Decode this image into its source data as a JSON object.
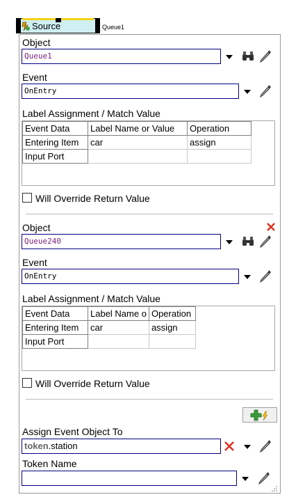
{
  "header": {
    "source_label": "Source",
    "queue_label": "Queue1"
  },
  "assignments": [
    {
      "object_label": "Object",
      "object_value": "Queue1",
      "event_label": "Event",
      "event_value": "OnEntry",
      "table_label": "Label Assignment / Match Value",
      "columns": [
        "Event Data",
        "Label Name or Value",
        "Operation"
      ],
      "rows": [
        {
          "event_data": "Entering Item",
          "value": "car",
          "operation": "assign"
        },
        {
          "event_data": "Input Port",
          "value": "",
          "operation": ""
        }
      ],
      "override_label": "Will Override Return Value",
      "override_checked": false
    },
    {
      "object_label": "Object",
      "object_value": "Queue240",
      "event_label": "Event",
      "event_value": "OnEntry",
      "table_label": "Label Assignment / Match Value",
      "columns": [
        "Event Data",
        "Label Name o",
        "Operation"
      ],
      "rows": [
        {
          "event_data": "Entering Item",
          "value": "car",
          "operation": "assign"
        },
        {
          "event_data": "Input Port",
          "value": "",
          "operation": ""
        }
      ],
      "override_label": "Will Override Return Value",
      "override_checked": false
    }
  ],
  "assign_event": {
    "label": "Assign Event Object To",
    "value_bold": "token",
    "value_rest": ".station"
  },
  "token_name": {
    "label": "Token Name",
    "value": ""
  },
  "colors": {
    "field_border": "#000080",
    "object_text": "#7a1f7a",
    "delete_red": "#e03020",
    "tab_yellow": "#f2d21c",
    "tab_bg": "#cfeff2"
  }
}
